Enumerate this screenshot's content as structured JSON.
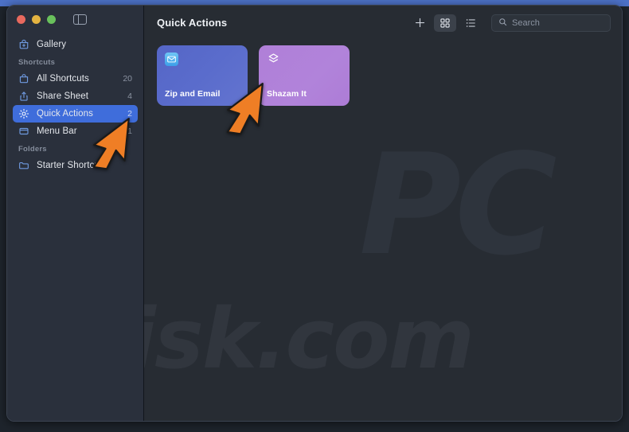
{
  "window": {
    "traffic_lights": [
      "close",
      "minimize",
      "zoom"
    ],
    "sidebar_toggle_icon": "sidebar-toggle-icon"
  },
  "sidebar": {
    "top_items": [
      {
        "label": "Gallery",
        "icon": "gallery-bag-icon",
        "count": ""
      }
    ],
    "sections": [
      {
        "header": "Shortcuts",
        "items": [
          {
            "label": "All Shortcuts",
            "icon": "shortcut-bag-icon",
            "count": "20",
            "selected": false
          },
          {
            "label": "Share Sheet",
            "icon": "share-icon",
            "count": "4",
            "selected": false
          },
          {
            "label": "Quick Actions",
            "icon": "gear-icon",
            "count": "2",
            "selected": true
          },
          {
            "label": "Menu Bar",
            "icon": "menubar-icon",
            "count": "1",
            "selected": false
          }
        ]
      },
      {
        "header": "Folders",
        "items": [
          {
            "label": "Starter Shortcuts",
            "icon": "folder-icon",
            "count": "",
            "selected": false
          }
        ]
      }
    ]
  },
  "toolbar": {
    "title": "Quick Actions",
    "add_label": "+",
    "add_icon": "plus-icon",
    "grid_view_icon": "grid-view-icon",
    "list_view_icon": "list-view-icon",
    "active_view": "grid"
  },
  "search": {
    "value": "",
    "placeholder": "Search",
    "icon": "search-icon"
  },
  "main": {
    "cards": [
      {
        "name": "Zip and Email",
        "icon": "mail-icon",
        "color": "#5a6ccc"
      },
      {
        "name": "Shazam It",
        "icon": "shazam-layers-icon",
        "color": "#b183da"
      }
    ]
  },
  "watermark": {
    "logo": "PC",
    "text": "risk.com"
  },
  "colors": {
    "accent_blue": "#3f6ddb",
    "top_band": "#4d72c8",
    "sidebar_bg": "#2a303c",
    "main_bg": "#272c33",
    "cursor_orange": "#ef7e25"
  }
}
